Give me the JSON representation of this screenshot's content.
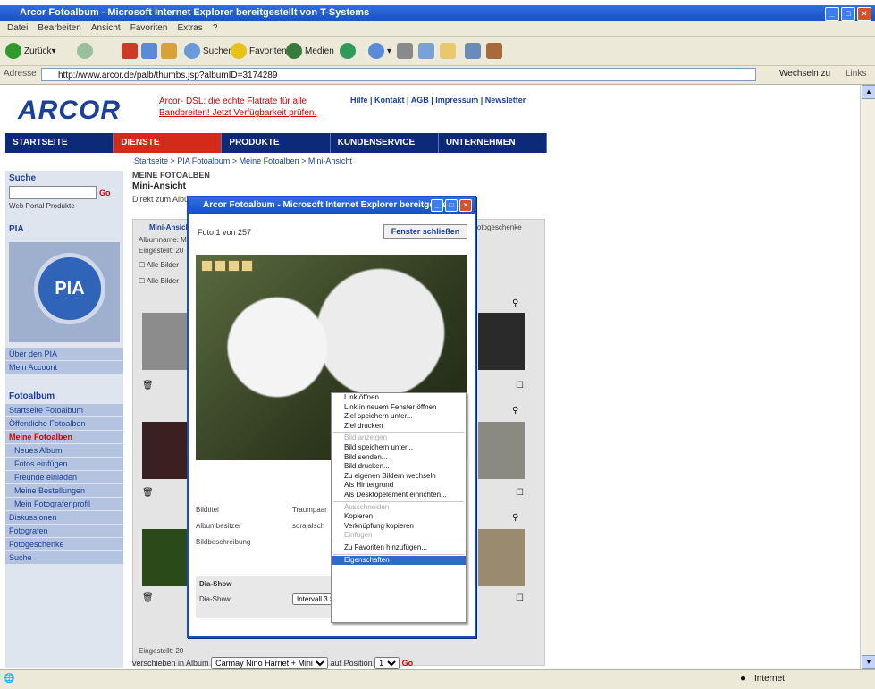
{
  "window": {
    "title": "Arcor Fotoalbum - Microsoft Internet Explorer bereitgestellt von T-Systems"
  },
  "menu": [
    "Datei",
    "Bearbeiten",
    "Ansicht",
    "Favoriten",
    "Extras",
    "?"
  ],
  "toolbar": {
    "back": "Zurück",
    "search": "Suchen",
    "favorites": "Favoriten",
    "media": "Medien"
  },
  "address": {
    "label": "Adresse",
    "url": "http://www.arcor.de/palb/thumbs.jsp?albumID=3174289",
    "go": "Wechseln zu",
    "links": "Links"
  },
  "site": {
    "logo": "ARCOR",
    "promo": "Arcor- DSL: die echte Flatrate für alle Bandbreiten! Jetzt Verfügbarkeit prüfen.",
    "toplinks": "Hilfe | Kontakt | AGB | Impressum | Newsletter",
    "nav": [
      "STARTSEITE",
      "DIENSTE",
      "PRODUKTE",
      "KUNDENSERVICE",
      "UNTERNEHMEN"
    ],
    "breadcrumb": "Startseite > PIA Fotoalbum > Meine Fotoalben > Mini-Ansicht"
  },
  "left": {
    "search_head": "Suche",
    "search_go": "Go",
    "radios": "Web  Portal  Produkte",
    "pia_head": "PIA",
    "pia_logo": "PIA",
    "links1": [
      "Über den PIA",
      "Mein Account"
    ],
    "album_head": "Fotoalbum",
    "album_links": [
      "Startseite Fotoalbum",
      "Öffentliche Fotoalben"
    ],
    "my_albums": "Meine Fotoalben",
    "sub_links": [
      "Neues Album",
      "Fotos einfügen",
      "Freunde einladen",
      "Meine Bestellungen",
      "Mein Fotografenprofil"
    ],
    "bottom_links": [
      "Diskussionen",
      "Fotografen",
      "Fotogeschenke",
      "Suche"
    ]
  },
  "main": {
    "title": "MEINE FOTOALBEN",
    "subtitle": "Mini-Ansicht",
    "desc": "Direkt zum Album",
    "tab_label": "Mini-Ansicht",
    "right_tab": "Fotogeschenke",
    "album_owner": "Albumname: M",
    "eingestellt": "Eingestellt: 20",
    "alle1": "Alle Bilder",
    "alle2": "Alle Bilder",
    "bottom_eingestellt": "Eingestellt: 20",
    "move_label": "verschieben  in Album",
    "move_album": "Carmay Nino Harriet + Mini",
    "position_label": "auf Position",
    "position_value": "1",
    "move_go": "Go"
  },
  "popup": {
    "title": "Arcor Fotoalbum - Microsoft Internet Explorer bereitgestellt...",
    "counter": "Foto 1 von 257",
    "close": "Fenster schließen",
    "info": [
      {
        "k": "Bildtitel",
        "v": "Traumpaar"
      },
      {
        "k": "Albumbesitzer",
        "v": "sorajalsch"
      },
      {
        "k": "Bildbeschreibung",
        "v": ""
      }
    ],
    "slideshow_head": "Dia-Show",
    "slideshow_label": "Dia-Show",
    "slideshow_value": "Intervall 3 S"
  },
  "context_menu": [
    {
      "label": "Link öffnen",
      "disabled": false
    },
    {
      "label": "Link in neuem Fenster öffnen",
      "disabled": false
    },
    {
      "label": "Ziel speichern unter...",
      "disabled": false
    },
    {
      "label": "Ziel drucken",
      "disabled": false
    },
    {
      "sep": true
    },
    {
      "label": "Bild anzeigen",
      "disabled": true
    },
    {
      "label": "Bild speichern unter...",
      "disabled": false
    },
    {
      "label": "Bild senden...",
      "disabled": false
    },
    {
      "label": "Bild drucken...",
      "disabled": false
    },
    {
      "label": "Zu eigenen Bildern wechseln",
      "disabled": false
    },
    {
      "label": "Als Hintergrund",
      "disabled": false
    },
    {
      "label": "Als Desktopelement einrichten...",
      "disabled": false
    },
    {
      "sep": true
    },
    {
      "label": "Ausschneiden",
      "disabled": true
    },
    {
      "label": "Kopieren",
      "disabled": false
    },
    {
      "label": "Verknüpfung kopieren",
      "disabled": false
    },
    {
      "label": "Einfügen",
      "disabled": true
    },
    {
      "sep": true
    },
    {
      "label": "Zu Favoriten hinzufügen...",
      "disabled": false
    },
    {
      "sep": true
    },
    {
      "label": "Eigenschaften",
      "disabled": false,
      "highlight": true
    }
  ],
  "status": {
    "zone": "Internet"
  },
  "colors": {
    "accent": "#1c3f98",
    "nav": "#0d2a78",
    "active": "#d42a1a",
    "xp_title": "#1a4fc4"
  }
}
